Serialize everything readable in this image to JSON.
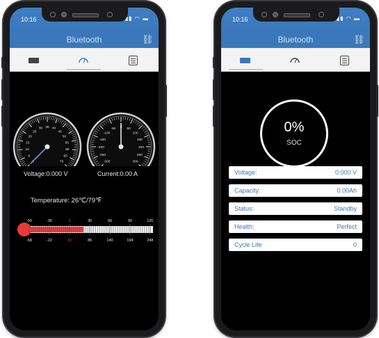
{
  "status_bar": {
    "time": "10:16"
  },
  "nav": {
    "title": "Bluetooth"
  },
  "icons": {
    "link": "link-icon",
    "battery": "battery-icon",
    "gauge": "gauge-icon",
    "document": "document-icon"
  },
  "colors": {
    "accent": "#3a78bb",
    "thermometer_bulb": "#e83a3a",
    "needle": "#5aa0e6"
  },
  "left_screen": {
    "voltage_gauge": {
      "ticks": [
        "0",
        "5",
        "10",
        "15",
        "20",
        "25",
        "30",
        "35",
        "40",
        "45",
        "50",
        "55",
        "60",
        "65",
        "70"
      ],
      "value": 0
    },
    "current_gauge": {
      "ticks": [
        "-300",
        "-250",
        "-200",
        "-150",
        "-100",
        "-50",
        "0",
        "50",
        "100",
        "150",
        "200",
        "250",
        "300"
      ],
      "value": 0
    },
    "voltage_text": "Voltage:0.000 V",
    "current_text": "Current:0.00 A",
    "temperature_text": "Temperature:  26℃/79℉",
    "thermometer": {
      "celsius_ticks": [
        "-50",
        "-30",
        "0",
        "30",
        "60",
        "90",
        "120"
      ],
      "fahrenheit_ticks": [
        "-58",
        "-22",
        "32",
        "86",
        "140",
        "194",
        "248"
      ],
      "value_c": 26
    }
  },
  "right_screen": {
    "soc_value": "0%",
    "soc_label": "SOC",
    "rows": [
      {
        "label": "Voltage:",
        "value": "0.000 V"
      },
      {
        "label": "Capacity:",
        "value": "0.00Ah"
      },
      {
        "label": "Status:",
        "value": "Standby"
      },
      {
        "label": "Health:",
        "value": "Perfect"
      },
      {
        "label": "Cycle Life",
        "value": "0"
      }
    ]
  }
}
